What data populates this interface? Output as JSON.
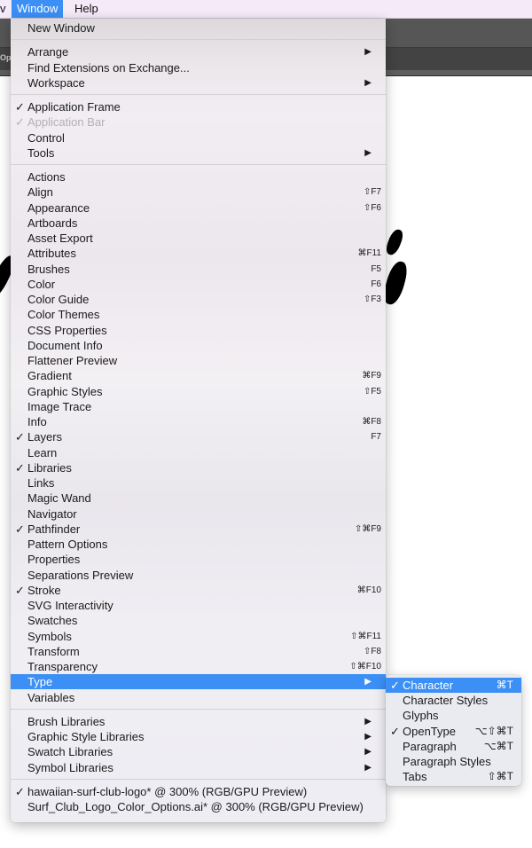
{
  "menubar": {
    "partial_left": "v",
    "items": [
      {
        "label": "Window",
        "active": true
      },
      {
        "label": "Help",
        "active": false
      }
    ]
  },
  "background": {
    "toolbar_fragment": "Opt"
  },
  "colors": {
    "highlight": "#3b8ff5",
    "menubar_bg": "#f4eaf8",
    "disabled_text": "#b3b0b6"
  },
  "window_menu": {
    "groups": [
      [
        {
          "label": "New Window"
        }
      ],
      [
        {
          "label": "Arrange",
          "submenu": true
        },
        {
          "label": "Find Extensions on Exchange..."
        },
        {
          "label": "Workspace",
          "submenu": true
        }
      ],
      [
        {
          "label": "Application Frame",
          "checked": true
        },
        {
          "label": "Application Bar",
          "checked": true,
          "disabled": true
        },
        {
          "label": "Control"
        },
        {
          "label": "Tools",
          "submenu": true
        }
      ],
      [
        {
          "label": "Actions"
        },
        {
          "label": "Align",
          "shortcut": "⇧F7"
        },
        {
          "label": "Appearance",
          "shortcut": "⇧F6"
        },
        {
          "label": "Artboards"
        },
        {
          "label": "Asset Export"
        },
        {
          "label": "Attributes",
          "shortcut": "⌘F11"
        },
        {
          "label": "Brushes",
          "shortcut": "F5"
        },
        {
          "label": "Color",
          "shortcut": "F6"
        },
        {
          "label": "Color Guide",
          "shortcut": "⇧F3"
        },
        {
          "label": "Color Themes"
        },
        {
          "label": "CSS Properties"
        },
        {
          "label": "Document Info"
        },
        {
          "label": "Flattener Preview"
        },
        {
          "label": "Gradient",
          "shortcut": "⌘F9"
        },
        {
          "label": "Graphic Styles",
          "shortcut": "⇧F5"
        },
        {
          "label": "Image Trace"
        },
        {
          "label": "Info",
          "shortcut": "⌘F8"
        },
        {
          "label": "Layers",
          "checked": true,
          "shortcut": "F7"
        },
        {
          "label": "Learn"
        },
        {
          "label": "Libraries",
          "checked": true
        },
        {
          "label": "Links"
        },
        {
          "label": "Magic Wand"
        },
        {
          "label": "Navigator"
        },
        {
          "label": "Pathfinder",
          "checked": true,
          "shortcut": "⇧⌘F9"
        },
        {
          "label": "Pattern Options"
        },
        {
          "label": "Properties"
        },
        {
          "label": "Separations Preview"
        },
        {
          "label": "Stroke",
          "checked": true,
          "shortcut": "⌘F10"
        },
        {
          "label": "SVG Interactivity"
        },
        {
          "label": "Swatches"
        },
        {
          "label": "Symbols",
          "shortcut": "⇧⌘F11"
        },
        {
          "label": "Transform",
          "shortcut": "⇧F8"
        },
        {
          "label": "Transparency",
          "shortcut": "⇧⌘F10"
        },
        {
          "label": "Type",
          "submenu": true,
          "highlighted": true
        },
        {
          "label": "Variables"
        }
      ],
      [
        {
          "label": "Brush Libraries",
          "submenu": true
        },
        {
          "label": "Graphic Style Libraries",
          "submenu": true
        },
        {
          "label": "Swatch Libraries",
          "submenu": true
        },
        {
          "label": "Symbol Libraries",
          "submenu": true
        }
      ],
      [
        {
          "label": "hawaiian-surf-club-logo* @ 300% (RGB/GPU Preview)",
          "checked": true
        },
        {
          "label": "Surf_Club_Logo_Color_Options.ai* @ 300% (RGB/GPU Preview)"
        }
      ]
    ]
  },
  "type_submenu": {
    "items": [
      {
        "label": "Character",
        "checked": true,
        "shortcut": "⌘T",
        "highlighted": true
      },
      {
        "label": "Character Styles"
      },
      {
        "label": "Glyphs"
      },
      {
        "label": "OpenType",
        "checked": true,
        "shortcut": "⌥⇧⌘T"
      },
      {
        "label": "Paragraph",
        "shortcut": "⌥⌘T"
      },
      {
        "label": "Paragraph Styles"
      },
      {
        "label": "Tabs",
        "shortcut": "⇧⌘T"
      }
    ]
  },
  "glyphs": {
    "check": "✓",
    "submenu_arrow": "▶"
  }
}
